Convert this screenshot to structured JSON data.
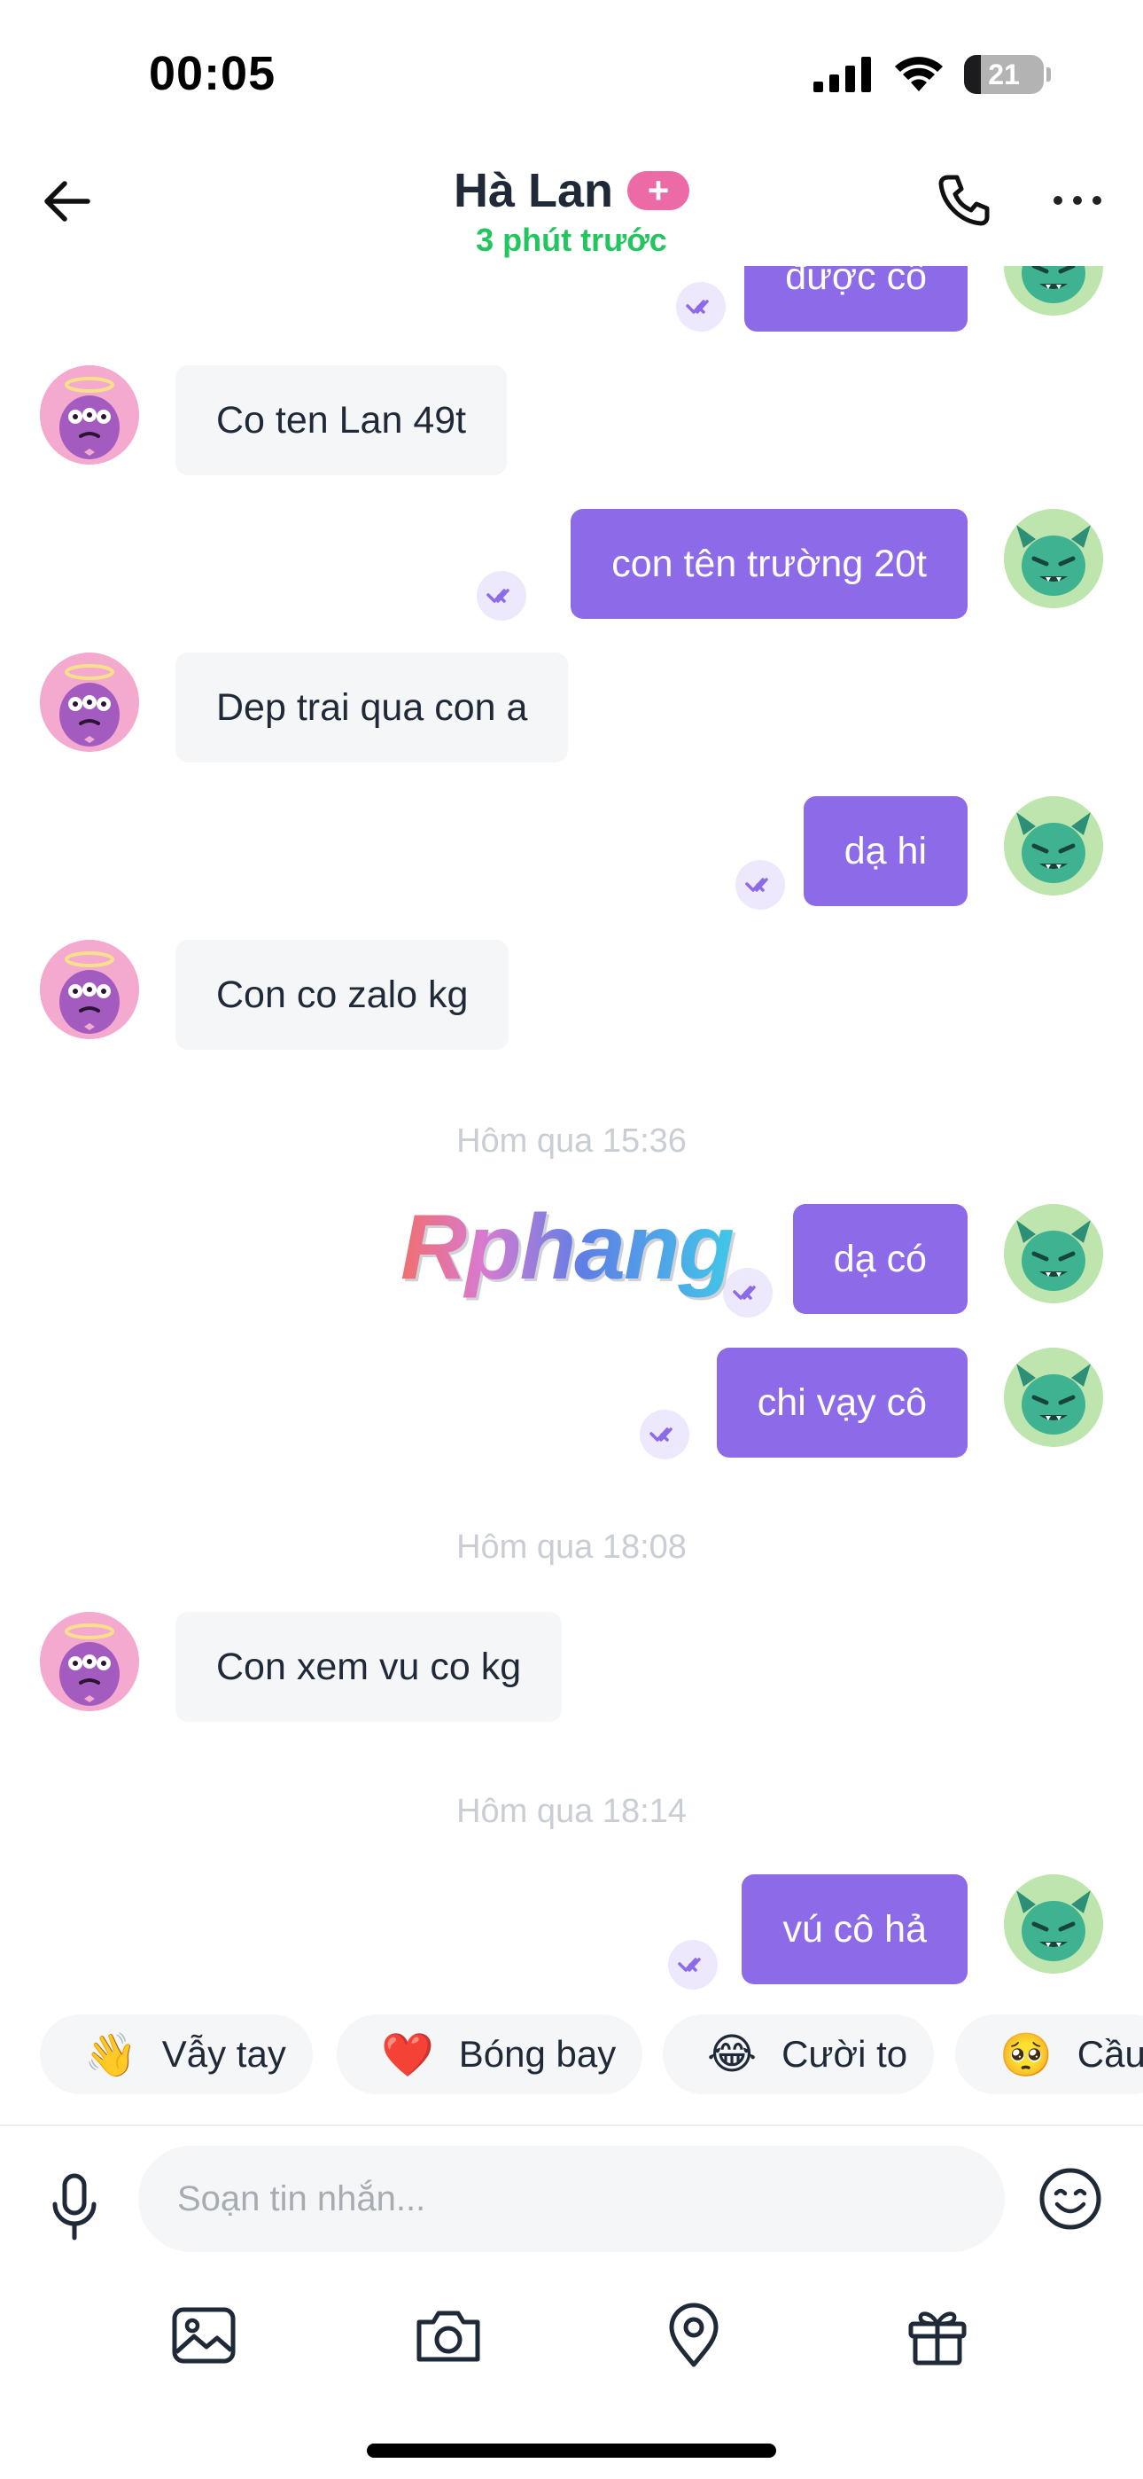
{
  "status_bar": {
    "time": "00:05",
    "battery": "21",
    "battery_level": 0.21
  },
  "header": {
    "contact_name": "Hà Lan",
    "badge": "+",
    "status": "3 phút trước"
  },
  "messages": [
    {
      "side": "out",
      "text": "được cô"
    },
    {
      "side": "in",
      "text": "Co ten Lan 49t"
    },
    {
      "side": "out",
      "text": "con tên trường 20t"
    },
    {
      "side": "in",
      "text": "Dep trai qua con a"
    },
    {
      "side": "out",
      "text": "dạ hi"
    },
    {
      "side": "in",
      "text": "Con co zalo kg"
    },
    {
      "side": "time",
      "text": "Hôm qua 15:36"
    },
    {
      "side": "out",
      "text": "dạ có"
    },
    {
      "side": "out",
      "text": "chi vạy cô"
    },
    {
      "side": "time",
      "text": "Hôm qua 18:08"
    },
    {
      "side": "in",
      "text": "Con xem vu co kg"
    },
    {
      "side": "time",
      "text": "Hôm qua 18:14"
    },
    {
      "side": "out",
      "text": "vú cô hả"
    }
  ],
  "watermark": "Rphang",
  "quick_reactions": [
    {
      "emoji": "👋",
      "label": "Vẫy tay"
    },
    {
      "emoji": "❤️",
      "label": "Bóng bay"
    },
    {
      "emoji": "😂",
      "label": "Cười to"
    },
    {
      "emoji": "🥺",
      "label": "Cầu"
    }
  ],
  "composer": {
    "placeholder": "Soạn tin nhắn..."
  },
  "toolbar": {
    "icons": [
      "image-icon",
      "camera-icon",
      "location-pin-icon",
      "gift-icon"
    ]
  },
  "colors": {
    "accent": "#8d6be8",
    "online": "#22c55e",
    "badge": "#ec6aa5",
    "incoming_bubble": "#f5f6f8"
  }
}
